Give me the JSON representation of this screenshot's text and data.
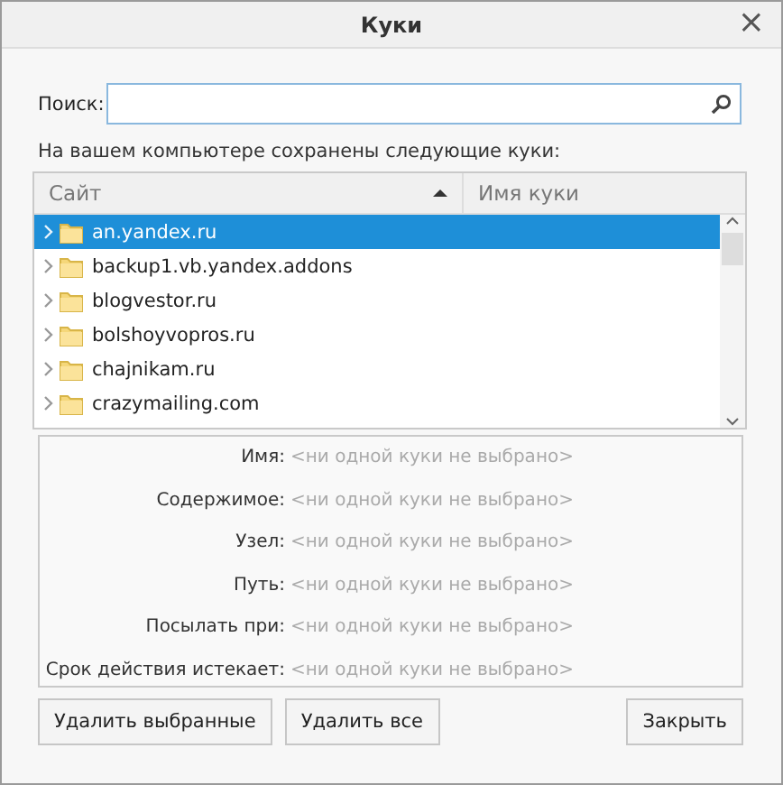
{
  "window": {
    "title": "Куки",
    "close": "×"
  },
  "search": {
    "label": "Поиск:"
  },
  "intro": "На вашем компьютере сохранены следующие куки:",
  "tree": {
    "columns": [
      {
        "label": "Сайт",
        "sorted": true
      },
      {
        "label": "Имя куки",
        "sorted": false
      }
    ],
    "rows": [
      {
        "label": "an.yandex.ru",
        "selected": true,
        "expanded": false
      },
      {
        "label": "backup1.vb.yandex.addons",
        "selected": false,
        "expanded": false
      },
      {
        "label": "blogvestor.ru",
        "selected": false,
        "expanded": false
      },
      {
        "label": "bolshoyvopros.ru",
        "selected": false,
        "expanded": false
      },
      {
        "label": "chajnikam.ru",
        "selected": false,
        "expanded": false
      },
      {
        "label": "crazymailing.com",
        "selected": false,
        "expanded": false
      }
    ]
  },
  "details": [
    {
      "label": "Имя:",
      "value": "<ни одной куки не выбрано>"
    },
    {
      "label": "Содержимое:",
      "value": "<ни одной куки не выбрано>"
    },
    {
      "label": "Узел:",
      "value": "<ни одной куки не выбрано>"
    },
    {
      "label": "Путь:",
      "value": "<ни одной куки не выбрано>"
    },
    {
      "label": "Посылать при:",
      "value": "<ни одной куки не выбрано>"
    },
    {
      "label": "Срок действия истекает:",
      "value": "<ни одной куки не выбрано>"
    }
  ],
  "buttons": [
    {
      "label": "Удалить выбранные",
      "kind": "left"
    },
    {
      "label": "Удалить все",
      "kind": "left"
    },
    {
      "label": "Закрыть",
      "kind": "right"
    }
  ]
}
